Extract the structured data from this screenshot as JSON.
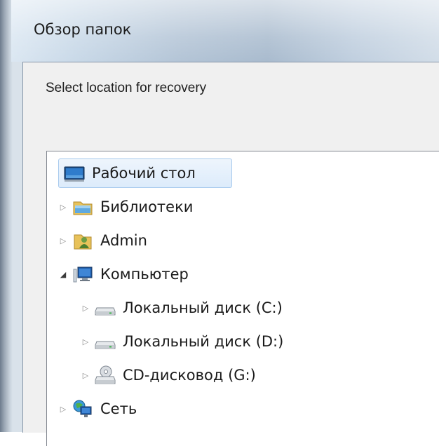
{
  "window": {
    "title": "Обзор папок"
  },
  "dialog": {
    "prompt": "Select location for recovery"
  },
  "tree": {
    "items": [
      {
        "label": "Рабочий стол",
        "icon": "desktop-icon",
        "expanded": null,
        "selected": true
      },
      {
        "label": "Библиотеки",
        "icon": "libraries-folder-icon",
        "expanded": false
      },
      {
        "label": "Admin",
        "icon": "user-folder-icon",
        "expanded": false
      },
      {
        "label": "Компьютер",
        "icon": "computer-icon",
        "expanded": true
      },
      {
        "label": "Локальный диск (C:)",
        "icon": "hard-drive-icon",
        "expanded": false
      },
      {
        "label": "Локальный диск (D:)",
        "icon": "hard-drive-icon",
        "expanded": false
      },
      {
        "label": "CD-дисковод (G:)",
        "icon": "cd-drive-icon",
        "expanded": false
      },
      {
        "label": "Сеть",
        "icon": "network-icon",
        "expanded": false
      }
    ]
  },
  "colors": {
    "selection_border": "#a9cbee",
    "selection_fill": "#dcebfb"
  }
}
